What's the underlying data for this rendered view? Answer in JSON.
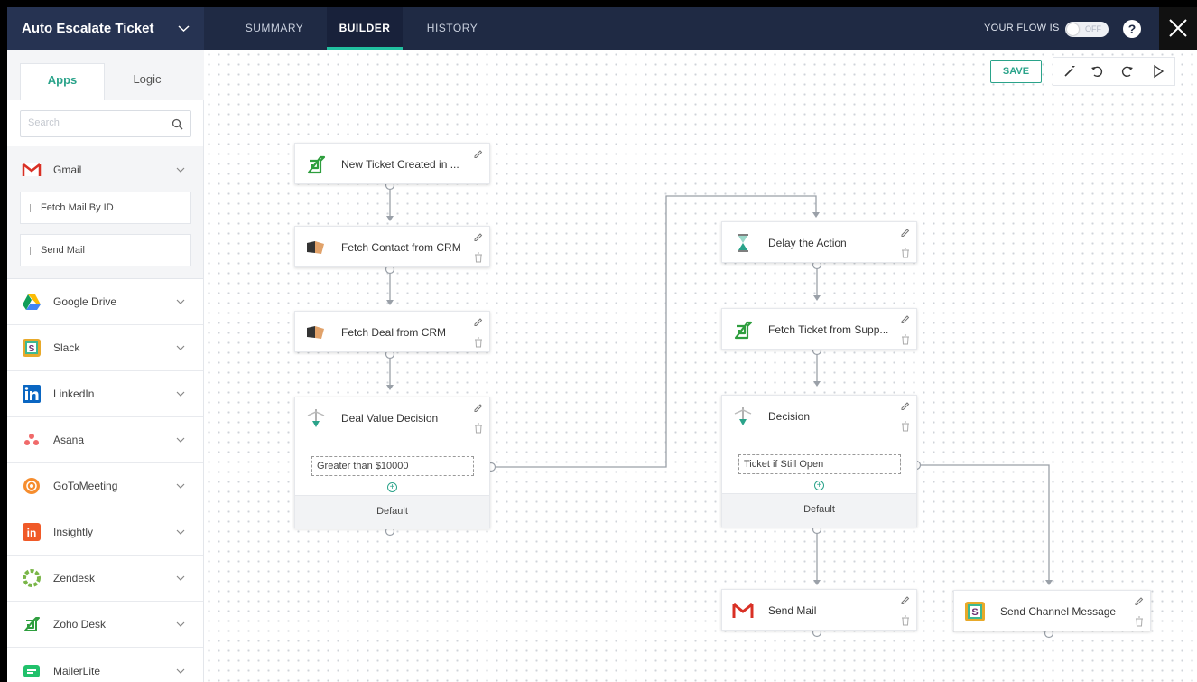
{
  "header": {
    "flow_title": "Auto Escalate Ticket",
    "tabs": [
      {
        "label": "SUMMARY"
      },
      {
        "label": "BUILDER"
      },
      {
        "label": "HISTORY"
      }
    ],
    "flow_status_label": "YOUR FLOW IS",
    "toggle_text": "OFF",
    "help_label": "?"
  },
  "sidebar": {
    "tabs": [
      {
        "label": "Apps"
      },
      {
        "label": "Logic"
      }
    ],
    "search_placeholder": "Search",
    "apps": [
      {
        "label": "Gmail",
        "icon": "gmail-icon"
      },
      {
        "label": "Google Drive",
        "icon": "google-drive-icon"
      },
      {
        "label": "Slack",
        "icon": "slack-icon"
      },
      {
        "label": "LinkedIn",
        "icon": "linkedin-icon"
      },
      {
        "label": "Asana",
        "icon": "asana-icon"
      },
      {
        "label": "GoToMeeting",
        "icon": "gotomeeting-icon"
      },
      {
        "label": "Insightly",
        "icon": "insightly-icon"
      },
      {
        "label": "Zendesk",
        "icon": "zendesk-icon"
      },
      {
        "label": "Zoho Desk",
        "icon": "zoho-desk-icon"
      },
      {
        "label": "MailerLite",
        "icon": "mailerlite-icon"
      }
    ],
    "gmail_actions": [
      {
        "label": "Fetch Mail By ID"
      },
      {
        "label": "Send Mail"
      }
    ]
  },
  "canvas": {
    "save_label": "SAVE",
    "nodes": {
      "trigger": {
        "title": "New Ticket Created in ..."
      },
      "fetch_contact": {
        "title": "Fetch Contact from CRM"
      },
      "fetch_deal": {
        "title": "Fetch Deal from CRM"
      },
      "deal_decision": {
        "title": "Deal Value Decision",
        "condition": "Greater than $10000",
        "default": "Default"
      },
      "delay": {
        "title": "Delay the Action"
      },
      "fetch_ticket": {
        "title": "Fetch Ticket from Supp..."
      },
      "decision": {
        "title": "Decision",
        "condition": "Ticket if Still Open",
        "default": "Default"
      },
      "send_mail": {
        "title": "Send Mail"
      },
      "send_channel": {
        "title": "Send Channel Message"
      }
    }
  },
  "colors": {
    "topbar": "#1f2a44",
    "accent": "#2aa38a",
    "gmail_red": "#d93025",
    "zoho_green": "#2e9e3e"
  }
}
